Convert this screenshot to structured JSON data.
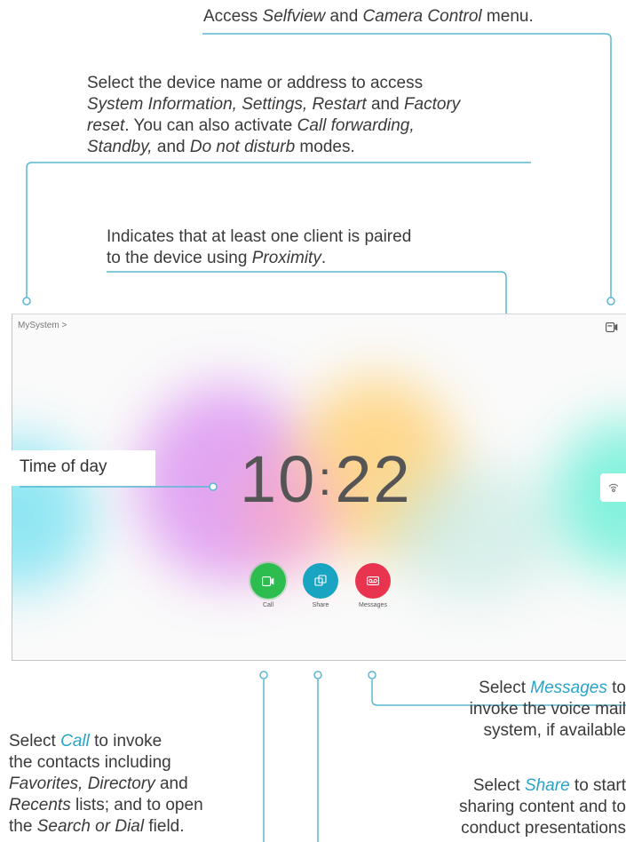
{
  "callouts": {
    "selfview": {
      "pre": "Access ",
      "em1": "Selfview",
      "mid": " and ",
      "em2": "Camera Control",
      "post": " menu."
    },
    "device": {
      "l1": "Select the device name or address to access",
      "l2_em": "System Information, Settings, Restart",
      "l2_mid": " and ",
      "l2_em2": "Factory",
      "l3_em": "reset",
      "l3_post": ". You can also activate ",
      "l3_em2": "Call forwarding,",
      "l4_em": "Standby,",
      "l4_mid": " and ",
      "l4_em2": "Do not disturb",
      "l4_post": " modes."
    },
    "proximity": {
      "l1": "Indicates that at least one client is paired",
      "l2_pre": "to the device using ",
      "l2_em": "Proximity",
      "l2_post": "."
    },
    "time_of_day": "Time of day",
    "messages": {
      "pre": "Select ",
      "hl": "Messages",
      "post": " to",
      "l2": "invoke the voice mail",
      "l3": "system, if available"
    },
    "call": {
      "pre": "Select ",
      "hl": "Call",
      "post": " to invoke",
      "l2": "the contacts including",
      "l3_em": "Favorites, Directory",
      "l3_post": " and",
      "l4_em": "Recents",
      "l4_post": " lists; and to open",
      "l5_pre": "the ",
      "l5_em": "Search or Dial",
      "l5_post": " field."
    },
    "share": {
      "pre": "Select ",
      "hl": "Share",
      "post": " to start",
      "l2": "sharing content and to",
      "l3": "conduct presentations"
    }
  },
  "device_ui": {
    "system_name": "MySystem >",
    "clock_hours": "10",
    "clock_separator": ":",
    "clock_minutes": "22",
    "buttons": [
      {
        "label": "Call",
        "color": "#2dbd4e",
        "icon": "video-camera-icon"
      },
      {
        "label": "Share",
        "color": "#19a4c2",
        "icon": "share-screen-icon"
      },
      {
        "label": "Messages",
        "color": "#e8344f",
        "icon": "voicemail-icon"
      }
    ]
  },
  "colors": {
    "accent_line": "#2aa3c8",
    "highlight_text": "#2aa3c8"
  }
}
